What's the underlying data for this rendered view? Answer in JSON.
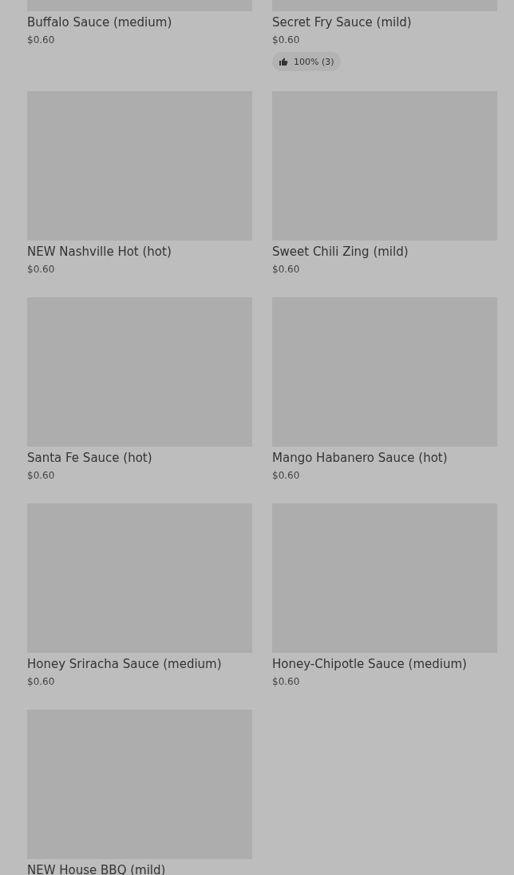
{
  "items": [
    {
      "name": "Buffalo Sauce (medium)",
      "price": "$0.60"
    },
    {
      "name": "Secret Fry Sauce (mild)",
      "price": "$0.60",
      "rating": "100% (3)"
    },
    {
      "name": "NEW Nashville Hot (hot)",
      "price": "$0.60"
    },
    {
      "name": "Sweet Chili Zing (mild)",
      "price": "$0.60"
    },
    {
      "name": "Santa Fe Sauce (hot)",
      "price": "$0.60"
    },
    {
      "name": "Mango Habanero Sauce (hot)",
      "price": "$0.60"
    },
    {
      "name": "Honey Sriracha Sauce (medium)",
      "price": "$0.60"
    },
    {
      "name": "Honey-Chipotle Sauce (medium)",
      "price": "$0.60"
    },
    {
      "name": "NEW House BBQ (mild)"
    }
  ]
}
